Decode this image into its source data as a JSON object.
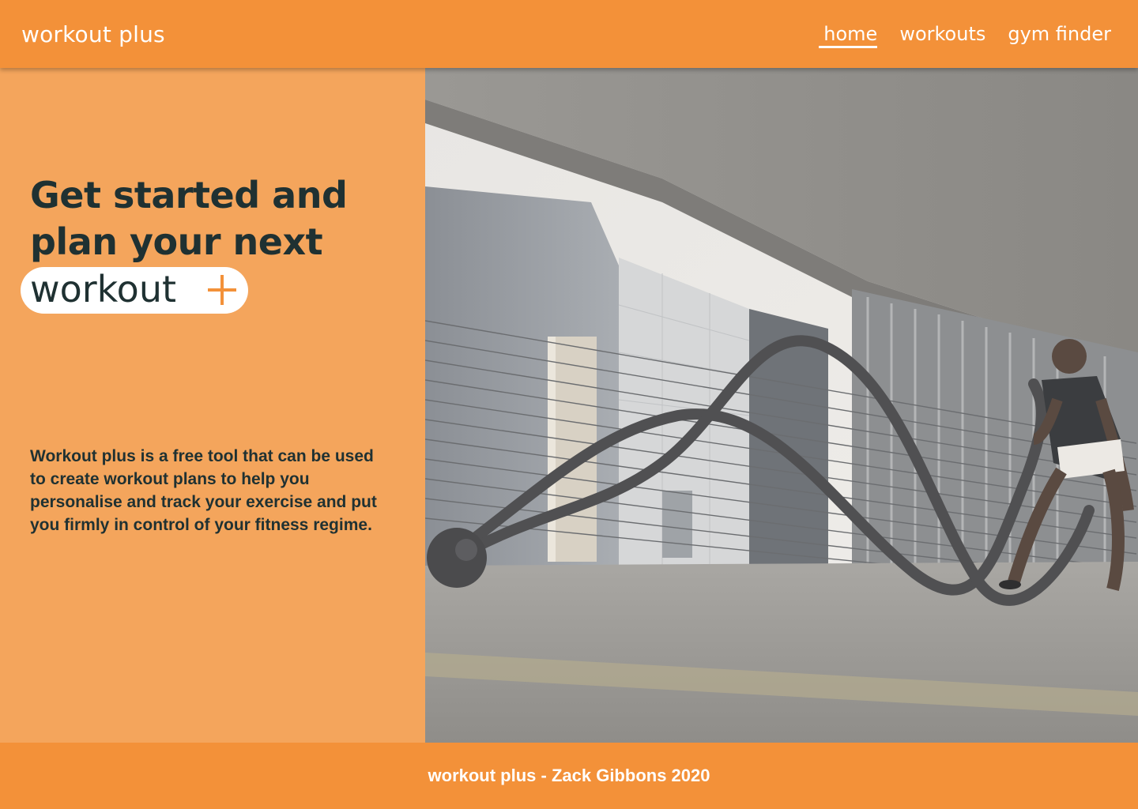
{
  "header": {
    "brand": "workout plus",
    "nav": [
      {
        "label": "home",
        "active": true
      },
      {
        "label": "workouts",
        "active": false
      },
      {
        "label": "gym finder",
        "active": false
      }
    ]
  },
  "hero_text": {
    "headline_line1": "Get started and",
    "headline_line2": "plan your next",
    "pill_word": "workout",
    "pill_icon": "plus-icon",
    "description": "Workout plus is a free tool that can be used to create workout plans to help you personalise and track your exercise and put you firmly in control of your fitness regime."
  },
  "hero_image": {
    "subject": "battle-ropes-athlete-photo"
  },
  "footer": {
    "text": "workout plus - Zack Gibbons 2020"
  },
  "colors": {
    "header_orange": "#f39139",
    "panel_orange": "#f4a55c",
    "text_dark": "#1f3132",
    "white": "#ffffff"
  }
}
